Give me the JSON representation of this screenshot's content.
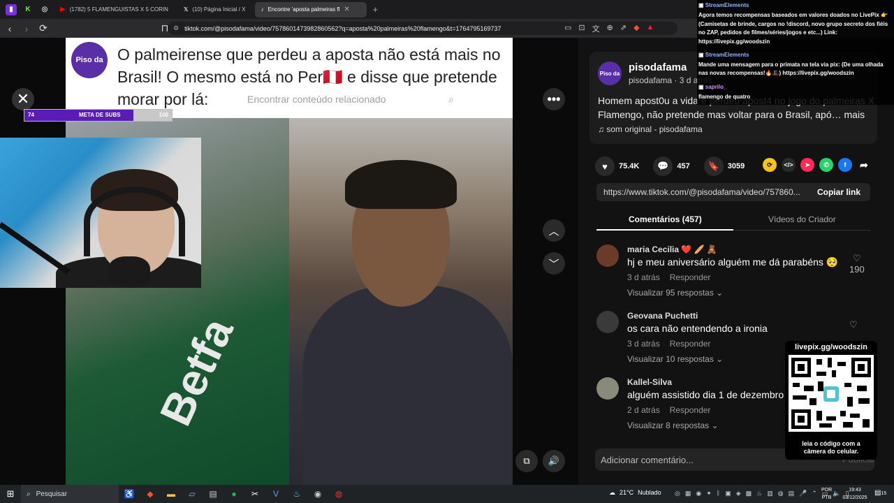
{
  "browser": {
    "tabs": [
      {
        "label": "(1782) 5 FLAMENGUISTAS X 5 CORIN"
      },
      {
        "label": "(10) Página Inicial / X"
      },
      {
        "label": "Encontre 'aposta palmeiras fl"
      }
    ],
    "new_tab": "+",
    "url": "tiktok.com/@pisodafama/video/7578601473982860562?q=aposta%20palmeiras%20flamengo&t=1764795169737"
  },
  "video": {
    "caption": "O palmeirense que perdeu a aposta não está mais no Brasil! O mesmo está no Per🇵🇪 e disse que pretende morar por lá:",
    "logo_text": "Piso da",
    "related_text": "Encontrar conteúdo relacionado",
    "jersey_text": "Betfa"
  },
  "meta_subs": {
    "current": "74",
    "label": "META DE SUBS",
    "goal": "100",
    "progress": 0.74
  },
  "post": {
    "username": "pisodafama",
    "sub": "pisodafama · 3 d atrás",
    "avatar_text": "Piso da",
    "description": "Homem apost0u a vida e perdeu apost4 no jogo do palmeiras X Flamengo, não pretende mas voltar para o Brasil, apó… mais",
    "sound": "♫  som original - pisodafama",
    "likes": "75.4K",
    "comments": "457",
    "saves": "3059",
    "link": "https://www.tiktok.com/@pisodafama/video/757860...",
    "copy_link": "Copiar link"
  },
  "tabs": {
    "comments": "Comentários (457)",
    "creator_videos": "Vídeos do Criador"
  },
  "comments": [
    {
      "name": "maria Cecilia ❤️ 🥖 🧸",
      "text": "hj e meu aniversário alguém me dá parabéns 🥺",
      "time": "3 d atrás",
      "reply": "Responder",
      "replies": "Visualizar 95 respostas ⌄",
      "likes": "190",
      "color": "#6b3a2a"
    },
    {
      "name": "Geovana Puchetti",
      "text": "os cara não entendendo a ironia",
      "time": "3 d atrás",
      "reply": "Responder",
      "replies": "Visualizar 10 respostas ⌄",
      "likes": "",
      "color": "#444"
    },
    {
      "name": "Kallel-Silva",
      "text": "alguém assistido dia 1 de dezembro 😊",
      "time": "2 d atrás",
      "reply": "Responder",
      "replies": "Visualizar 8 respostas ⌄",
      "likes": "",
      "color": "#8a8a7a"
    }
  ],
  "add_comment": {
    "placeholder": "Adicionar comentário...",
    "publish": "Publicar"
  },
  "streamelements": {
    "source": "StreamElements",
    "msg1": "Agora temos recompensas baseados em valores doados no LivePix 👉",
    "msg1b": "(Camisetas de brinde, cargos no !discord, novo grupo secreto dos fiéis",
    "msg1c": "no ZAP, pedidos de filmes/séries/jogos e etc...) Link:",
    "msg1d": "https://livepix.gg/woodszin",
    "msg2": "Mande uma mensagem para o primata na tela via pix: (De uma olhada",
    "msg2b": "nas novas recompensas!🔥🎩) https://livepix.gg/woodszin",
    "user3": "saprilo_",
    "msg3": "flamengo de quatro"
  },
  "qr": {
    "title": "livepix.gg/woodszin",
    "footer1": "leia o código com a",
    "footer2": "câmera do celular."
  },
  "taskbar": {
    "search": "Pesquisar",
    "weather_temp": "21°C",
    "weather_desc": "Nublado",
    "lang1": "POR",
    "lang2": "PTB",
    "time": "19:43",
    "date": "03/12/2025",
    "notif_count": "15"
  }
}
